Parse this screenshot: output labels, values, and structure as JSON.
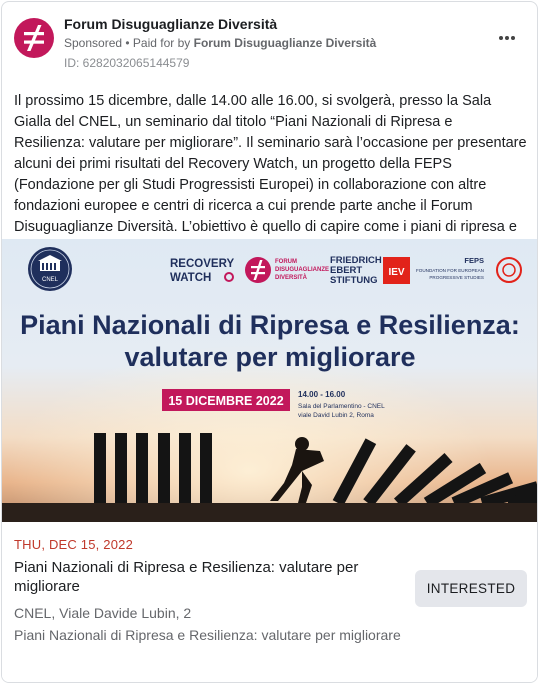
{
  "post": {
    "page_name": "Forum Disuguaglianze Diversità",
    "sponsored": "Sponsored",
    "paid_for_prefix": " • Paid for by ",
    "paid_for_name": "Forum Disuguaglianze Diversità",
    "ad_id": "ID: 6282032065144579",
    "body": "Il prossimo 15 dicembre, dalle 14.00 alle 16.00, si svolgerà, presso la Sala Gialla del CNEL, un seminario dal titolo “Piani Nazionali di Ripresa e Resilienza: valutare per migliorare”. Il seminario sarà l’occasione per presentare alcuni dei primi risultati del Recovery Watch, un progetto della FEPS (Fondazione per gli Studi Progressisti Europei) in collaborazione con altre fondazioni europee e centri di ricerca a cui prende parte anche il Forum Disuguaglianze Diversità. L’obiettivo è quello di capire come i piani di ripresa e resilienza influiranno sulla trasformazion…"
  },
  "banner": {
    "cnel_label": "CNEL",
    "recovery": "RECOVERY",
    "watch": "WATCH",
    "forum_line1": "FORUM",
    "forum_line2": "DISUGUAGLIANZE",
    "forum_line3": "DIVERSITÀ",
    "fes_line1": "FRIEDRICH",
    "fes_line2": "EBERT",
    "fes_line3": "STIFTUNG",
    "iev": "IEV",
    "feps": "FEPS",
    "feps_sub1": "FOUNDATION FOR EUROPEAN",
    "feps_sub2": "PROGRESSIVE STUDIES",
    "title_line1": "Piani Nazionali di Ripresa e Resilienza:",
    "title_line2": "valutare per migliorare",
    "date_badge": "15 DICEMBRE 2022",
    "time": "14.00 - 16.00",
    "venue": "Sala del Parlamentino - CNEL",
    "address": "viale David Lubin 2, Roma"
  },
  "event": {
    "date": "THU, DEC 15, 2022",
    "title": "Piani Nazionali di Ripresa e Resilienza: valutare per migliorare",
    "location": "CNEL, Viale Davide Lubin, 2",
    "description": "Piani Nazionali di Ripresa e Resilienza: valutare per migliorare",
    "interested_label": "INTERESTED"
  },
  "colors": {
    "brand": "#c2185b",
    "navy": "#1f2f5c",
    "event_date": "#c0392b",
    "iev_red": "#e2231a"
  },
  "icons": {
    "avatar": "not-equal-icon",
    "menu": "more-horizontal-icon"
  }
}
